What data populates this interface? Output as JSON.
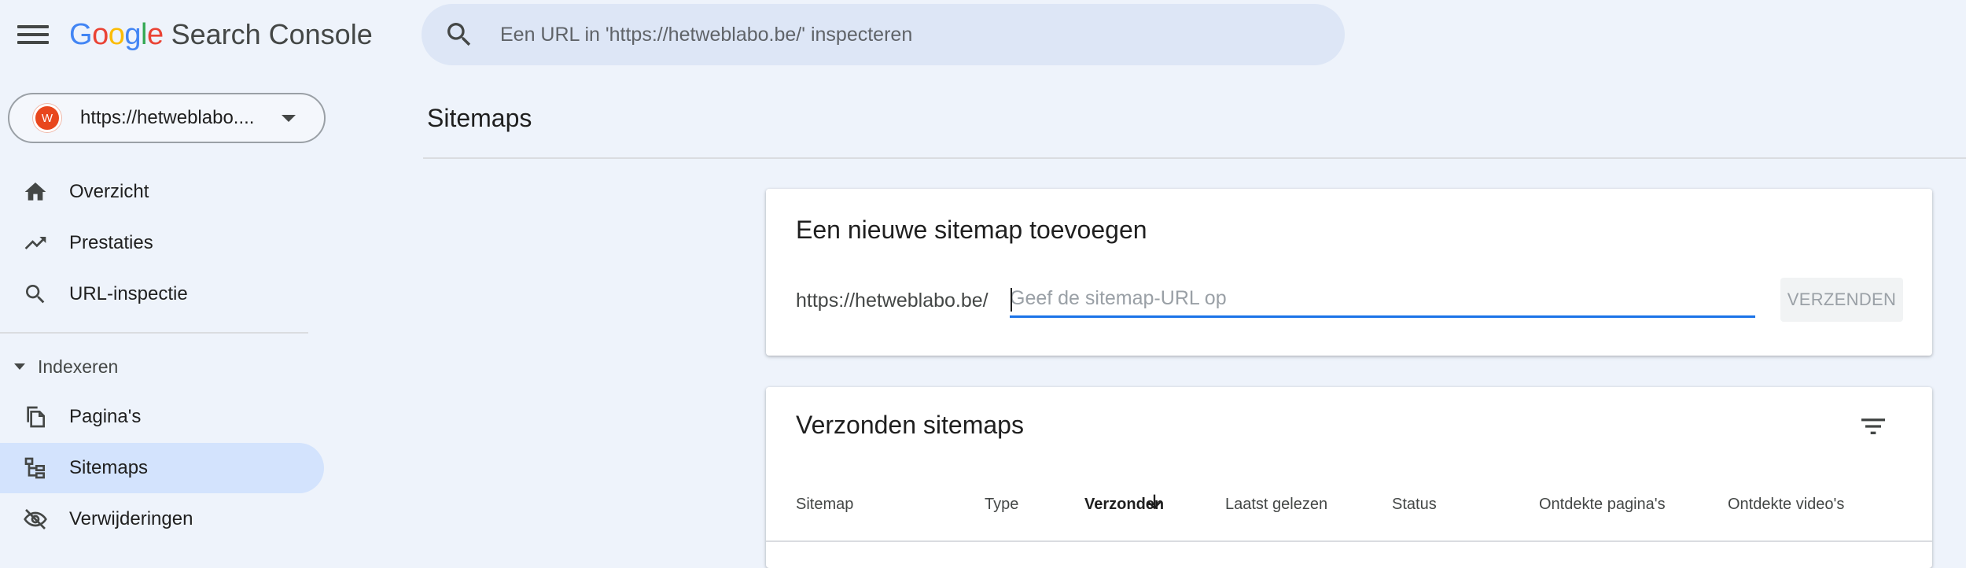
{
  "header": {
    "logo_letters": [
      {
        "char": "G",
        "color": "#4285F4"
      },
      {
        "char": "o",
        "color": "#EA4335"
      },
      {
        "char": "o",
        "color": "#FBBC05"
      },
      {
        "char": "g",
        "color": "#4285F4"
      },
      {
        "char": "l",
        "color": "#34A853"
      },
      {
        "char": "e",
        "color": "#EA4335"
      }
    ],
    "product_name": "Search Console",
    "search_placeholder": "Een URL in 'https://hetweblabo.be/' inspecteren",
    "menu_icon": "hamburger-menu-icon",
    "search_icon": "search-icon"
  },
  "property": {
    "favicon_letter": "W",
    "favicon_color": "#e8471d",
    "url": "https://hetweblabo...."
  },
  "sidebar": {
    "items": [
      {
        "label": "Overzicht",
        "icon": "home-icon"
      },
      {
        "label": "Prestaties",
        "icon": "trending-up-icon"
      },
      {
        "label": "URL-inspectie",
        "icon": "search-icon"
      }
    ],
    "section_label": "Indexeren",
    "section_items": [
      {
        "label": "Pagina's",
        "icon": "pages-icon"
      },
      {
        "label": "Sitemaps",
        "icon": "sitemap-icon",
        "active": true
      },
      {
        "label": "Verwijderingen",
        "icon": "eye-off-icon"
      }
    ],
    "active_color": "#d3e3fd"
  },
  "main": {
    "page_title": "Sitemaps",
    "add_card": {
      "title": "Een nieuwe sitemap toevoegen",
      "prefix": "https://hetweblabo.be/",
      "input_value": "",
      "input_placeholder": "Geef de sitemap-URL op",
      "submit_label": "VERZENDEN"
    },
    "submitted_card": {
      "title": "Verzonden sitemaps",
      "filter_icon": "filter-icon",
      "columns": [
        "Sitemap",
        "Type",
        "Verzonden",
        "Laatst gelezen",
        "Status",
        "Ontdekte pagina's",
        "Ontdekte video's"
      ],
      "sorted_column": "Verzonden",
      "sort_direction": "descending"
    },
    "accent_color": "#1a73e8"
  }
}
